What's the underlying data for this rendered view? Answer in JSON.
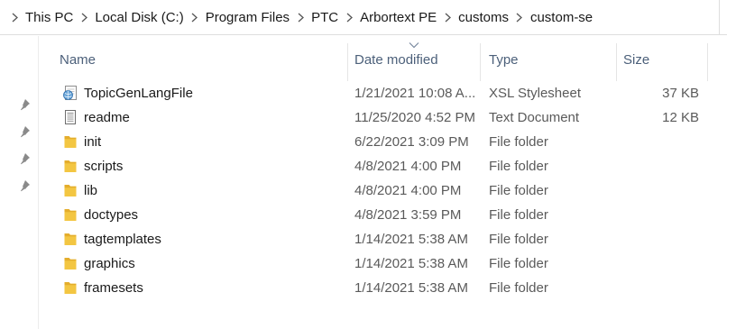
{
  "breadcrumb": {
    "items": [
      "This PC",
      "Local Disk (C:)",
      "Program Files",
      "PTC",
      "Arbortext PE",
      "customs",
      "custom-se"
    ]
  },
  "columns": {
    "name": "Name",
    "date_modified": "Date modified",
    "type": "Type",
    "size": "Size"
  },
  "files": [
    {
      "icon": "xsl-stylesheet-icon",
      "name": "TopicGenLangFile",
      "date": "1/21/2021 10:08 A...",
      "type": "XSL Stylesheet",
      "size": "37 KB"
    },
    {
      "icon": "text-document-icon",
      "name": "readme",
      "date": "11/25/2020 4:52 PM",
      "type": "Text Document",
      "size": "12 KB"
    },
    {
      "icon": "folder-icon",
      "name": "init",
      "date": "6/22/2021 3:09 PM",
      "type": "File folder",
      "size": ""
    },
    {
      "icon": "folder-icon",
      "name": "scripts",
      "date": "4/8/2021 4:00 PM",
      "type": "File folder",
      "size": ""
    },
    {
      "icon": "folder-icon",
      "name": "lib",
      "date": "4/8/2021 4:00 PM",
      "type": "File folder",
      "size": ""
    },
    {
      "icon": "folder-icon",
      "name": "doctypes",
      "date": "4/8/2021 3:59 PM",
      "type": "File folder",
      "size": ""
    },
    {
      "icon": "folder-icon",
      "name": "tagtemplates",
      "date": "1/14/2021 5:38 AM",
      "type": "File folder",
      "size": ""
    },
    {
      "icon": "folder-icon",
      "name": "graphics",
      "date": "1/14/2021 5:38 AM",
      "type": "File folder",
      "size": ""
    },
    {
      "icon": "folder-icon",
      "name": "framesets",
      "date": "1/14/2021 5:38 AM",
      "type": "File folder",
      "size": ""
    }
  ],
  "colors": {
    "header_text": "#4c607a",
    "folder_yellow": "#f3c642",
    "pin_gray": "#8a8a8a"
  }
}
